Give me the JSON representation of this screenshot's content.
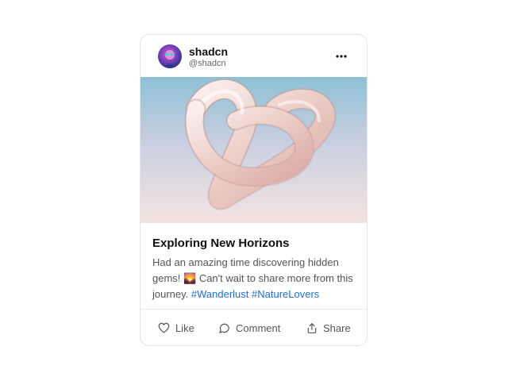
{
  "post": {
    "username": "shadcn",
    "handle": "@shadcn",
    "title": "Exploring New Horizons",
    "body_before": "Had an amazing time discovering hidden gems! ",
    "emoji": "🌄",
    "body_after": " Can't wait to share more from this journey. ",
    "tags": [
      "#Wanderlust",
      "#NatureLovers"
    ]
  },
  "actions": {
    "like_label": "Like",
    "comment_label": "Comment",
    "share_label": "Share"
  },
  "icons": {
    "more": "more-horizontal-icon",
    "like": "heart-icon",
    "comment": "message-circle-icon",
    "share": "share-icon"
  },
  "colors": {
    "hashtag": "#1f6fd1",
    "border": "#e4e4e7",
    "text_muted": "#555555"
  }
}
